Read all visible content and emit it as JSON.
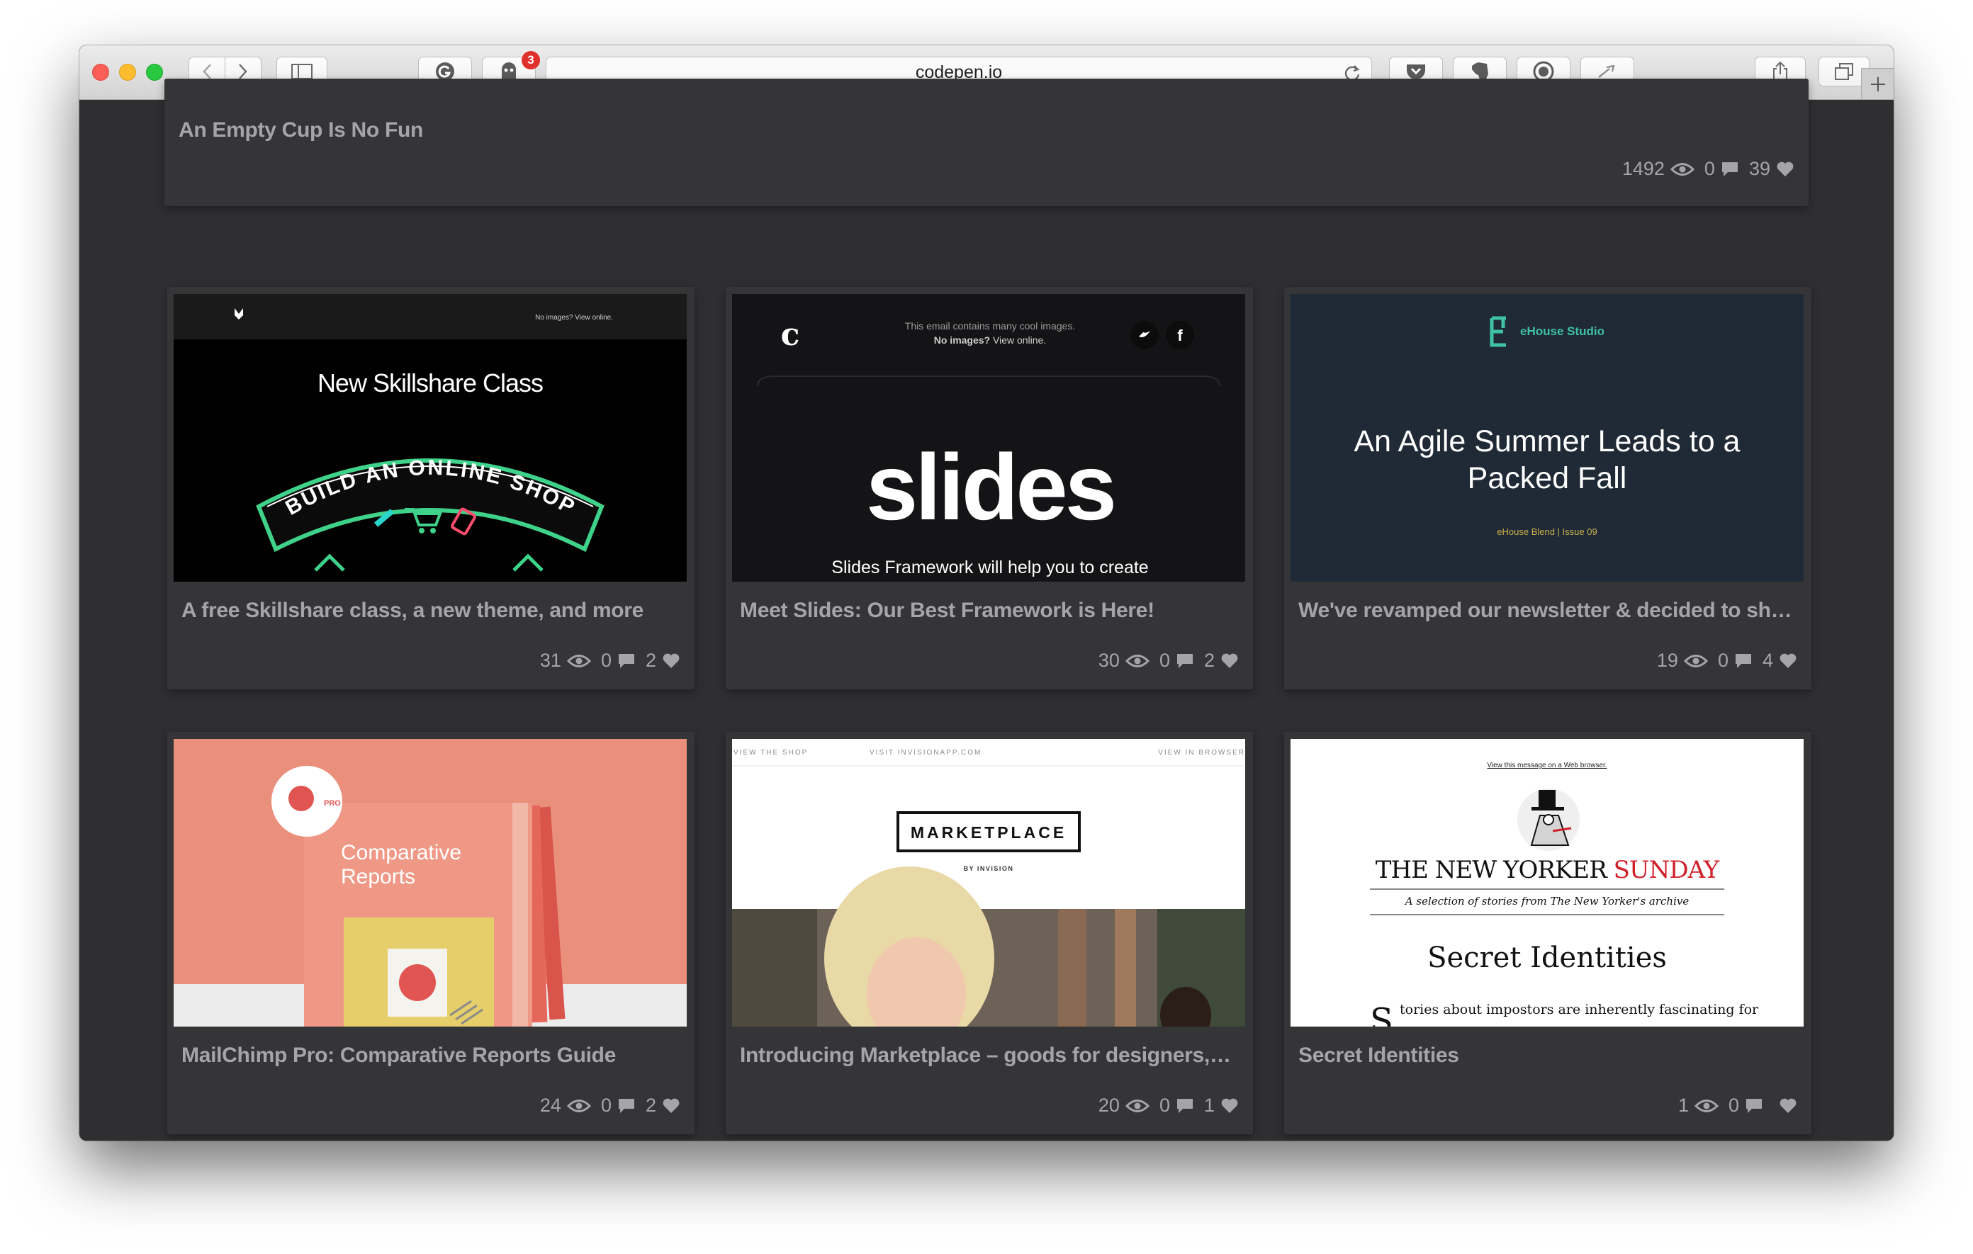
{
  "browser": {
    "url": "codepen.io",
    "notification_count": "3"
  },
  "top_card": {
    "title": "An Empty Cup Is No Fun",
    "views": "1492",
    "comments": "0",
    "hearts": "39"
  },
  "cards": [
    {
      "title": "A free Skillshare class, a new theme, and more",
      "views": "31",
      "comments": "0",
      "hearts": "2",
      "thumb": {
        "top_link": "No images? View online.",
        "heading": "New Skillshare Class",
        "banner": "BUILD AN ONLINE SHOP"
      }
    },
    {
      "title": "Meet Slides: Our Best Framework is Here!",
      "views": "30",
      "comments": "0",
      "hearts": "2",
      "thumb": {
        "line1": "This email contains many cool images.",
        "line2": "No images?",
        "line2b": "View online.",
        "logo": "slides",
        "tagline": "Slides Framework will help you to create"
      }
    },
    {
      "title": "We've revamped our newsletter & decided to sha...",
      "views": "19",
      "comments": "0",
      "hearts": "4",
      "thumb": {
        "brand": "eHouse Studio",
        "headline": "An Agile Summer Leads to a Packed Fall",
        "issue": "eHouse Blend | Issue 09"
      }
    },
    {
      "title": "MailChimp Pro: Comparative Reports Guide",
      "views": "24",
      "comments": "0",
      "hearts": "2",
      "thumb": {
        "pro": "PRO",
        "heading": "Comparative Reports"
      }
    },
    {
      "title": "Introducing Marketplace – goods for designers, b...",
      "views": "20",
      "comments": "0",
      "hearts": "1",
      "thumb": {
        "nav1": "VIEW THE SHOP",
        "nav2": "VISIT INVISIONAPP.COM",
        "nav3": "VIEW IN BROWSER",
        "logo": "MARKETPLACE",
        "by": "BY INVISION"
      }
    },
    {
      "title": "Secret Identities",
      "views": "1",
      "comments": "0",
      "hearts": "",
      "thumb": {
        "top_link": "View this message on a Web browser.",
        "masthead_a": "THE NEW YORKER",
        "masthead_b": "SUNDAY",
        "subtitle": "A selection of stories from The New Yorker's archive",
        "headline": "Secret Identities",
        "dropcap": "S",
        "body": "tories about impostors are inherently fascinating for"
      }
    }
  ],
  "colors": {
    "page_bg": "#2f2f32",
    "card_bg": "#353538",
    "meta_text": "#a5a5a8",
    "ehouse_accent": "#3fc1a4",
    "newyorker_red": "#d0202a"
  },
  "icons": [
    "back-icon",
    "forward-icon",
    "sidebar-icon",
    "grammarly-icon",
    "ghostery-icon",
    "reload-icon",
    "pocket-icon",
    "evernote-icon",
    "onepassword-icon",
    "dropper-icon",
    "share-icon",
    "tabs-icon",
    "plus-icon",
    "eye-icon",
    "comment-icon",
    "heart-icon"
  ]
}
